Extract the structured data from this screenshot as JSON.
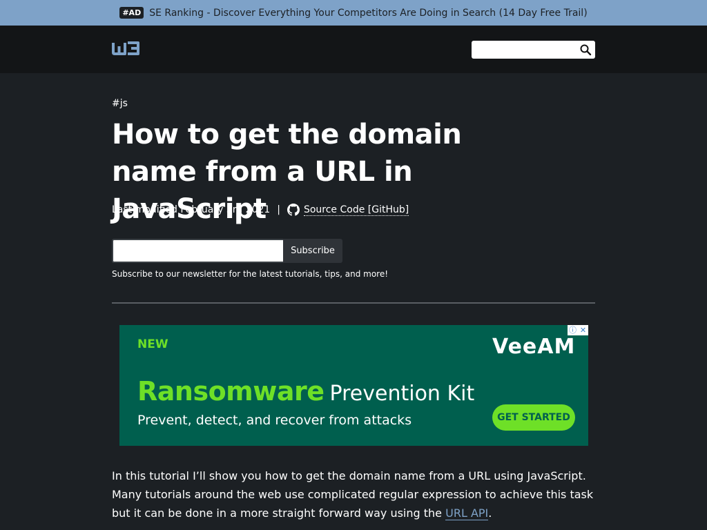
{
  "ad_bar": {
    "tag": "#AD",
    "text": "SE Ranking - Discover Everything Your Competitors Are Doing in Search (14 Day Free Trail)"
  },
  "header": {
    "logo_icon": "w3-logo-icon",
    "search": {
      "value": "",
      "placeholder": ""
    },
    "search_icon": "search-icon"
  },
  "article": {
    "tag": "#js",
    "title": "How to get the domain name from a URL in JavaScript",
    "last_modified": "Last modified February 3rd 2021",
    "separator": "|",
    "github_icon": "github-icon",
    "source_code_label": "Source Code [GitHub]"
  },
  "newsletter": {
    "input": {
      "value": "",
      "placeholder": ""
    },
    "button_label": "Subscribe",
    "note": "Subscribe to our newsletter for the latest tutorials, tips, and more!"
  },
  "ad_banner": {
    "badge": "NEW",
    "brand": "VeeAM",
    "headline_accent": "Ransomware",
    "headline_rest": "Prevention Kit",
    "subline": "Prevent, detect, and recover from attacks",
    "cta": "GET STARTED",
    "info_icon": "ⓘ",
    "close_icon": "✕",
    "colors": {
      "background": "#005f4e",
      "accent": "#6ee027"
    }
  },
  "intro": {
    "text_before": "In this tutorial I’ll show you how to get the domain name from a URL using JavaScript. Many tutorials around the web use complicated regular expression to achieve this task but it can be done in a more straight forward way using the ",
    "link_text": "URL API",
    "text_after": "."
  },
  "colors": {
    "page_bg": "#1c2024",
    "header_bg": "#131517",
    "ad_bar_bg": "#7ea2c8",
    "link": "#7ea2c8"
  }
}
